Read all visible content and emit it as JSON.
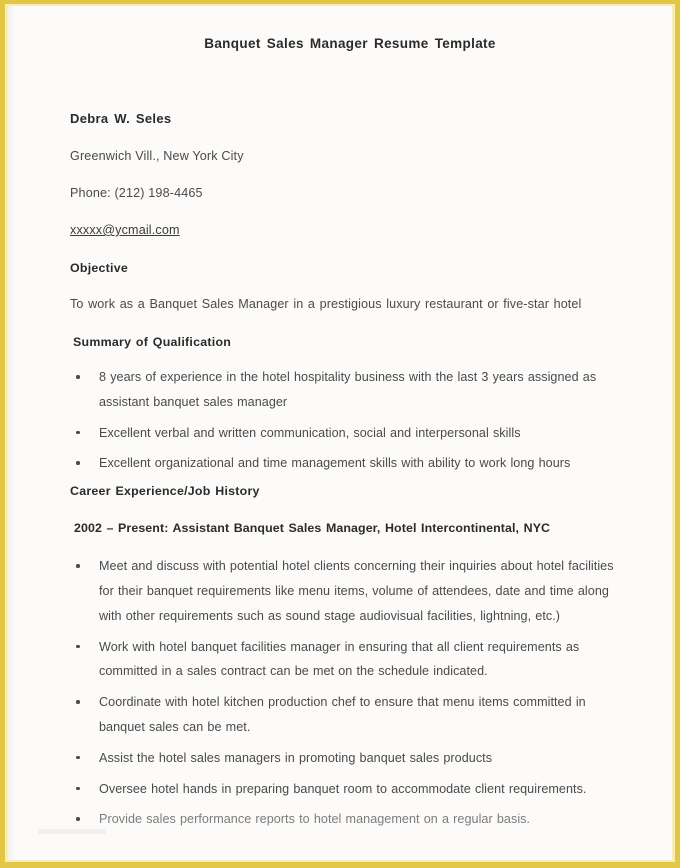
{
  "document": {
    "title": "Banquet Sales Manager Resume Template",
    "frame_color": "#e3c646",
    "page_background": "#fcfbfa",
    "text_color": "#4a4a4a"
  },
  "header": {
    "name": "Debra W. Seles",
    "address": "Greenwich Vill., New York City",
    "phone": "Phone: (212) 198-4465",
    "email": "xxxxx@ycmail.com"
  },
  "objective": {
    "heading": "Objective",
    "text": "To work as a Banquet Sales Manager in a prestigious luxury restaurant or five-star hotel"
  },
  "summary": {
    "heading": "Summary of Qualification",
    "items": [
      "8 years of experience in the hotel hospitality business with the last 3 years assigned as assistant banquet sales manager",
      "Excellent verbal and written communication, social and interpersonal skills",
      "Excellent organizational and time management skills with ability to work long hours"
    ]
  },
  "career": {
    "heading": "Career Experience/Job History",
    "job": {
      "title": "2002 – Present:  Assistant Banquet Sales Manager, Hotel Intercontinental, NYC",
      "duties": [
        "Meet and discuss with potential hotel clients concerning their inquiries about hotel facilities for their banquet requirements like menu items, volume of attendees, date and time along with other requirements such as sound stage audiovisual facilities, lightning, etc.)",
        "Work with hotel banquet facilities manager in ensuring that all client requirements as committed in a sales contract can be met on the schedule indicated.",
        "Coordinate with hotel kitchen production chef to ensure that menu items committed in banquet sales can be met.",
        "Assist the hotel sales managers in promoting banquet sales products",
        "Oversee hotel hands in preparing banquet room to accommodate client requirements.",
        "Provide sales performance reports to hotel management on a regular basis."
      ]
    }
  }
}
